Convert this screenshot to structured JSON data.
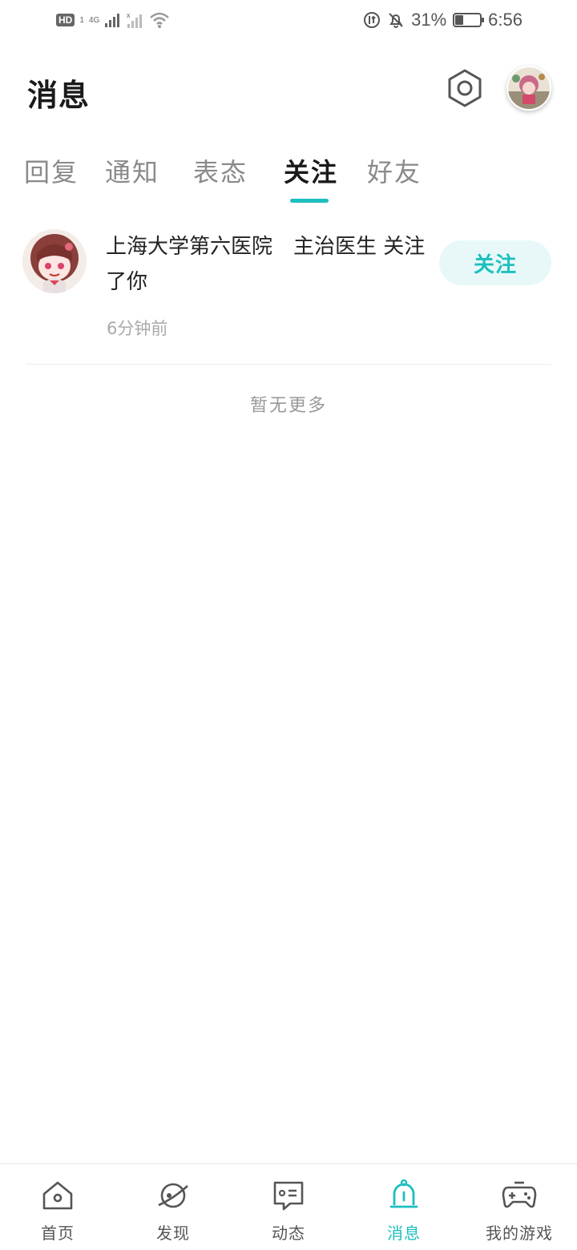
{
  "status_bar": {
    "hd": "HD",
    "sim": "1",
    "network": "4G",
    "battery_percent": "31%",
    "battery_level": 0.31,
    "time": "6:56"
  },
  "header": {
    "title": "消息"
  },
  "tabs": [
    {
      "label": "回复",
      "active": false
    },
    {
      "label": "通知",
      "active": false
    },
    {
      "label": "表态",
      "active": false
    },
    {
      "label": "关注",
      "active": true
    },
    {
      "label": "好友",
      "active": false
    }
  ],
  "notifications": [
    {
      "text": "上海大学第六医院　主治医生 关注了你",
      "time": "6分钟前",
      "action_label": "关注"
    }
  ],
  "footer_text": "暂无更多",
  "bottom_nav": [
    {
      "label": "首页",
      "icon": "home-icon",
      "active": false
    },
    {
      "label": "发现",
      "icon": "planet-icon",
      "active": false
    },
    {
      "label": "动态",
      "icon": "chat-icon",
      "active": false
    },
    {
      "label": "消息",
      "icon": "bell-icon",
      "active": true
    },
    {
      "label": "我的游戏",
      "icon": "gamepad-icon",
      "active": false
    }
  ],
  "colors": {
    "accent": "#1dbfbf",
    "accent_bg": "#e8f8f8",
    "text_primary": "#1a1a1a",
    "text_secondary": "#8a8a8a"
  }
}
